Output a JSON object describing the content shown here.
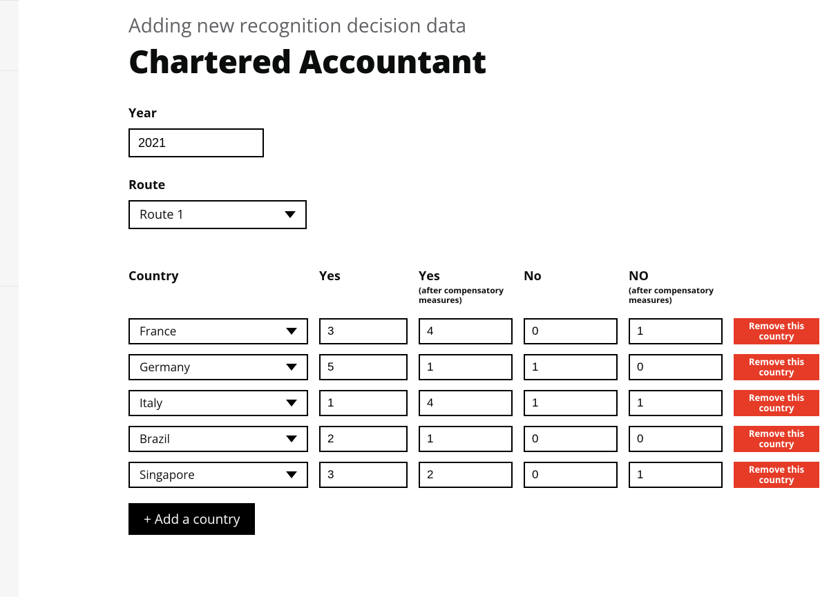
{
  "header": {
    "subtitle": "Adding new recognition decision data",
    "title": "Chartered Accountant"
  },
  "year_field": {
    "label": "Year",
    "value": "2021"
  },
  "route_field": {
    "label": "Route",
    "selected": "Route 1"
  },
  "table": {
    "headers": {
      "country": "Country",
      "yes": "Yes",
      "yes_after": {
        "title": "Yes",
        "sub": "(after compensatory measures)"
      },
      "no": "No",
      "no_after": {
        "title": "NO",
        "sub": "(after compensatory measures)"
      }
    },
    "rows": [
      {
        "country": "France",
        "yes": "3",
        "yes_after": "4",
        "no": "0",
        "no_after": "1"
      },
      {
        "country": "Germany",
        "yes": "5",
        "yes_after": "1",
        "no": "1",
        "no_after": "0"
      },
      {
        "country": "Italy",
        "yes": "1",
        "yes_after": "4",
        "no": "1",
        "no_after": "1"
      },
      {
        "country": "Brazil",
        "yes": "2",
        "yes_after": "1",
        "no": "0",
        "no_after": "0"
      },
      {
        "country": "Singapore",
        "yes": "3",
        "yes_after": "2",
        "no": "0",
        "no_after": "1"
      }
    ],
    "remove_label": "Remove this country",
    "add_label": "+ Add a country"
  }
}
